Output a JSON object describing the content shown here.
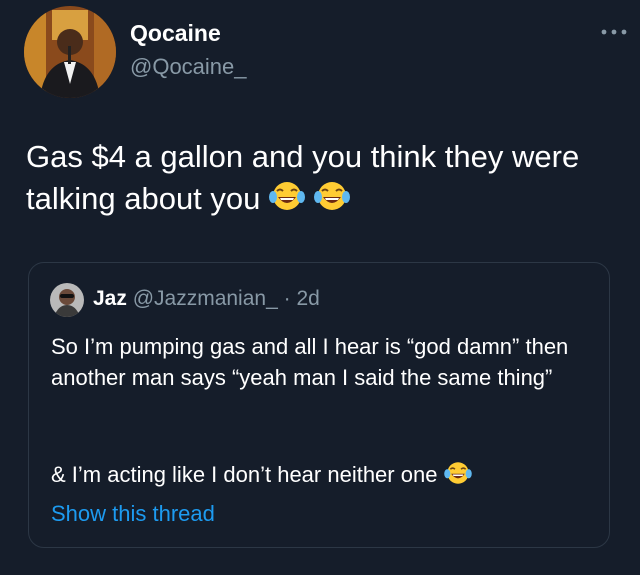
{
  "tweet": {
    "author_name": "Qocaine",
    "author_handle": "@Qocaine_",
    "text": "Gas $4 a gallon and you think they were talking about you",
    "emojis": [
      "tears-of-joy-icon",
      "tears-of-joy-icon"
    ]
  },
  "quote": {
    "author_name": "Jaz",
    "author_handle": "@Jazzmanian_",
    "separator": "·",
    "time": "2d",
    "text": "So I’m pumping gas and all I hear is “god damn” then another man says “yeah man I said the same thing”",
    "text2": "& I’m acting like I don’t hear neither one",
    "show_thread": "Show this thread"
  },
  "icons": {
    "more": "more-icon",
    "emoji": "tears-of-joy-icon"
  },
  "colors": {
    "background": "#151d2a",
    "text": "#ffffff",
    "secondary": "#8899a6",
    "link": "#1d9bf0",
    "border": "#2c3745"
  }
}
